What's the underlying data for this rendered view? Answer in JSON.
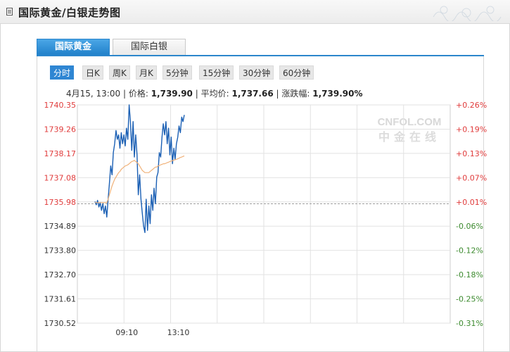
{
  "header": {
    "title": "国际黄金/白银走势图"
  },
  "tabs": [
    {
      "label": "国际黄金",
      "active": true
    },
    {
      "label": "国际白银",
      "active": false
    }
  ],
  "periods": [
    {
      "label": "分时",
      "active": true
    },
    {
      "label": "日K",
      "active": false
    },
    {
      "label": "周K",
      "active": false
    },
    {
      "label": "月K",
      "active": false
    },
    {
      "label": "5分钟",
      "active": false
    },
    {
      "label": "15分钟",
      "active": false
    },
    {
      "label": "30分钟",
      "active": false
    },
    {
      "label": "60分钟",
      "active": false
    }
  ],
  "info": {
    "datetime": "4月15, 13:00",
    "price_label": "价格:",
    "price": "1,739.90",
    "avg_label": "平均价:",
    "avg": "1,737.66",
    "change_label": "涨跌幅:",
    "change": "1,739.90%"
  },
  "watermark": {
    "top": "CNFOL.COM",
    "bottom": "中金在线"
  },
  "colors": {
    "accent": "#2f86d3",
    "price_line": "#1a5fb4",
    "avg_line": "#f0b27a",
    "up": "#e03b3b",
    "down": "#3c8a2e",
    "axis_text": "#333333"
  },
  "chart_data": {
    "type": "line",
    "title": "",
    "xlabel": "",
    "ylabel": "",
    "ylim": [
      1730.52,
      1740.35
    ],
    "y_ticks": [
      "1740.35",
      "1739.26",
      "1738.17",
      "1737.08",
      "1735.98",
      "1734.89",
      "1733.80",
      "1732.70",
      "1731.61",
      "1730.52"
    ],
    "y_ticks_right": [
      "+0.26%",
      "+0.19%",
      "+0.13%",
      "+0.07%",
      "+0.01%",
      "-0.06%",
      "-0.12%",
      "-0.18%",
      "-0.25%",
      "-0.31%"
    ],
    "x_ticks": [
      "09:10",
      "13:10"
    ],
    "reference_value": 1735.9,
    "grid": true,
    "series": [
      {
        "name": "",
        "values": [
          1736.0,
          1735.85,
          1736.05,
          1735.75,
          1735.95,
          1735.6,
          1735.9,
          1735.45,
          1735.8,
          1735.3,
          1736.1,
          1736.8,
          1737.6,
          1737.2,
          1738.2,
          1738.6,
          1739.2,
          1738.8,
          1739.0,
          1738.4,
          1739.1,
          1738.6,
          1739.0,
          1738.5,
          1739.3,
          1738.8,
          1740.35,
          1739.6,
          1738.3,
          1739.6,
          1738.0,
          1739.0,
          1738.1,
          1736.3,
          1737.2,
          1736.1,
          1735.5,
          1734.9,
          1734.6,
          1736.1,
          1734.7,
          1735.8,
          1735.0,
          1736.3,
          1735.6,
          1736.6,
          1735.9,
          1737.1,
          1737.3,
          1738.2,
          1738.0,
          1738.9,
          1739.5,
          1739.0,
          1739.6,
          1738.6,
          1739.3,
          1738.1,
          1738.9,
          1737.7,
          1738.4,
          1737.9,
          1738.6,
          1738.9,
          1739.4,
          1739.1,
          1739.8,
          1739.6,
          1739.9
        ]
      },
      {
        "name": "",
        "values": [
          1735.95,
          1735.95,
          1735.95,
          1735.95,
          1735.95,
          1735.95,
          1735.95,
          1735.95,
          1735.95,
          1735.95,
          1736.1,
          1736.3,
          1736.5,
          1736.7,
          1736.85,
          1737.0,
          1737.1,
          1737.2,
          1737.3,
          1737.35,
          1737.45,
          1737.5,
          1737.55,
          1737.6,
          1737.62,
          1737.65,
          1737.7,
          1737.75,
          1737.8,
          1737.82,
          1737.85,
          1737.8,
          1737.75,
          1737.7,
          1737.6,
          1737.5,
          1737.4,
          1737.35,
          1737.3,
          1737.3,
          1737.3,
          1737.3,
          1737.35,
          1737.4,
          1737.45,
          1737.5,
          1737.55,
          1737.55,
          1737.6,
          1737.62,
          1737.65,
          1737.67,
          1737.7,
          1737.7,
          1737.72,
          1737.75,
          1737.77,
          1737.8,
          1737.82,
          1737.84,
          1737.86,
          1737.88,
          1737.9,
          1737.92,
          1737.95,
          1737.98,
          1738.0,
          1738.03,
          1738.05
        ]
      }
    ]
  }
}
